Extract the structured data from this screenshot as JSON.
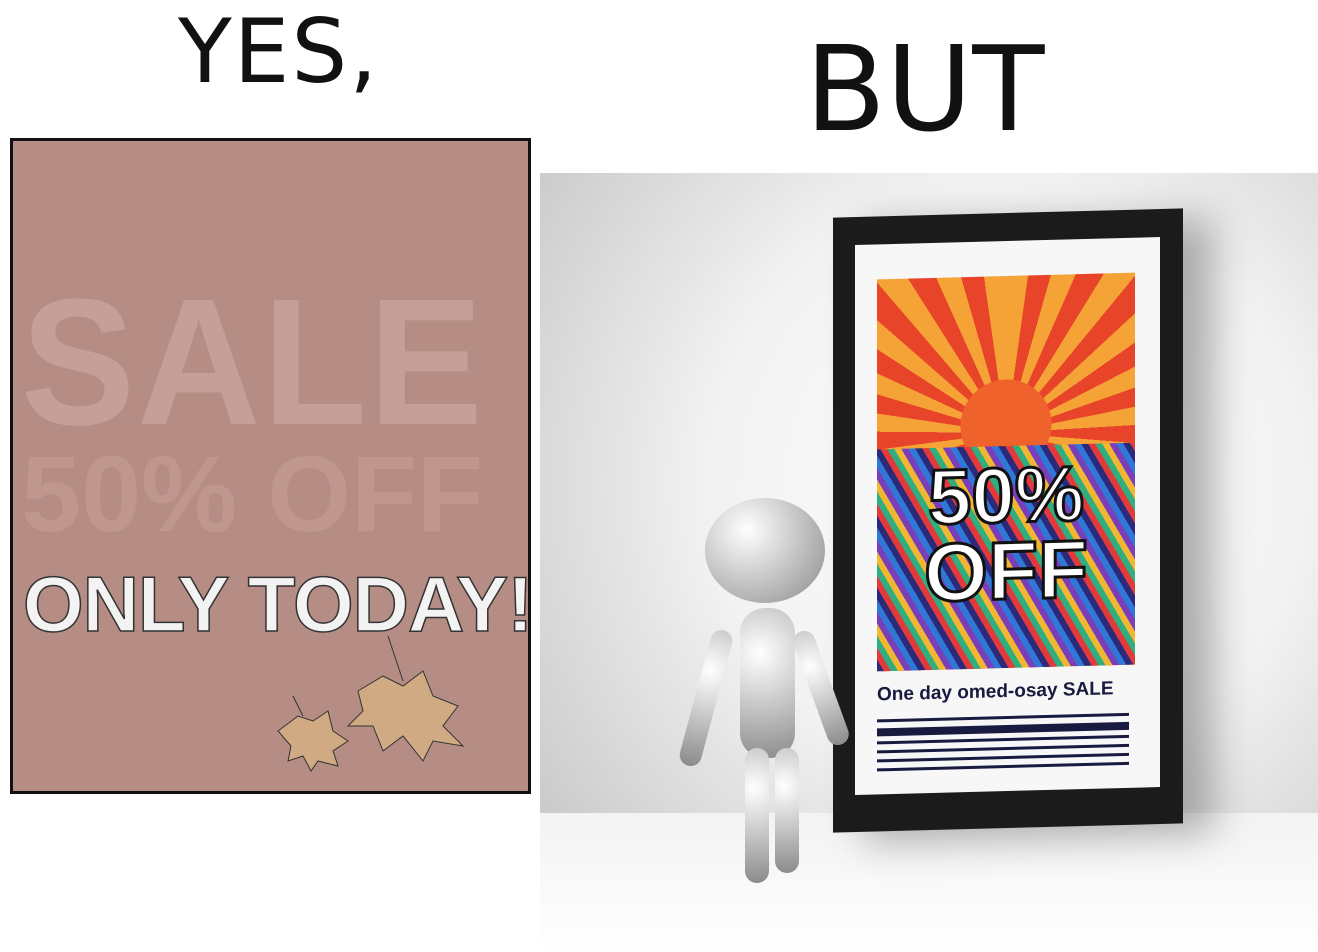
{
  "captions": {
    "left": "YES,",
    "right": "BUT"
  },
  "left_poster": {
    "line1": "SALE",
    "line2": "50% OFF",
    "line3": "ONLY TODAY!",
    "background": "#b58d84"
  },
  "right_poster": {
    "headline_1": "50%",
    "headline_2": "OFF",
    "subtitle": "One day omed-osay SALE"
  }
}
